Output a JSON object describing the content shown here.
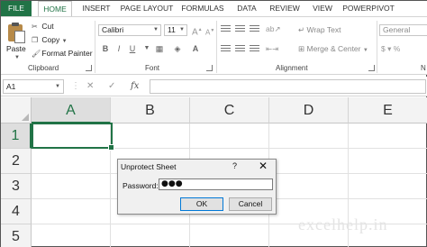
{
  "tabs": [
    "FILE",
    "HOME",
    "INSERT",
    "PAGE LAYOUT",
    "FORMULAS",
    "DATA",
    "REVIEW",
    "VIEW",
    "POWERPIVOT"
  ],
  "active_tab": "HOME",
  "ribbon": {
    "clipboard": {
      "paste_label": "Paste",
      "cut_label": "Cut",
      "copy_label": "Copy",
      "format_painter_label": "Format Painter",
      "group_label": "Clipboard"
    },
    "font": {
      "font_name": "Calibri",
      "font_size": "11",
      "bold": "B",
      "italic": "I",
      "underline": "U",
      "group_label": "Font"
    },
    "alignment": {
      "wrap_text_label": "Wrap Text",
      "merge_center_label": "Merge & Center",
      "group_label": "Alignment"
    },
    "number": {
      "format_value": "General",
      "group_label": "N"
    }
  },
  "formula_bar": {
    "name_box": "A1",
    "fx_label": "fx",
    "value": ""
  },
  "grid": {
    "columns": [
      "A",
      "B",
      "C",
      "D",
      "E"
    ],
    "rows": [
      "1",
      "2",
      "3",
      "4",
      "5"
    ]
  },
  "dialog": {
    "title": "Unprotect Sheet",
    "help": "?",
    "close": "✕",
    "password_label": "Password:",
    "password_value": "●●●",
    "ok_label": "OK",
    "cancel_label": "Cancel"
  },
  "watermark": "excelhelp.in"
}
